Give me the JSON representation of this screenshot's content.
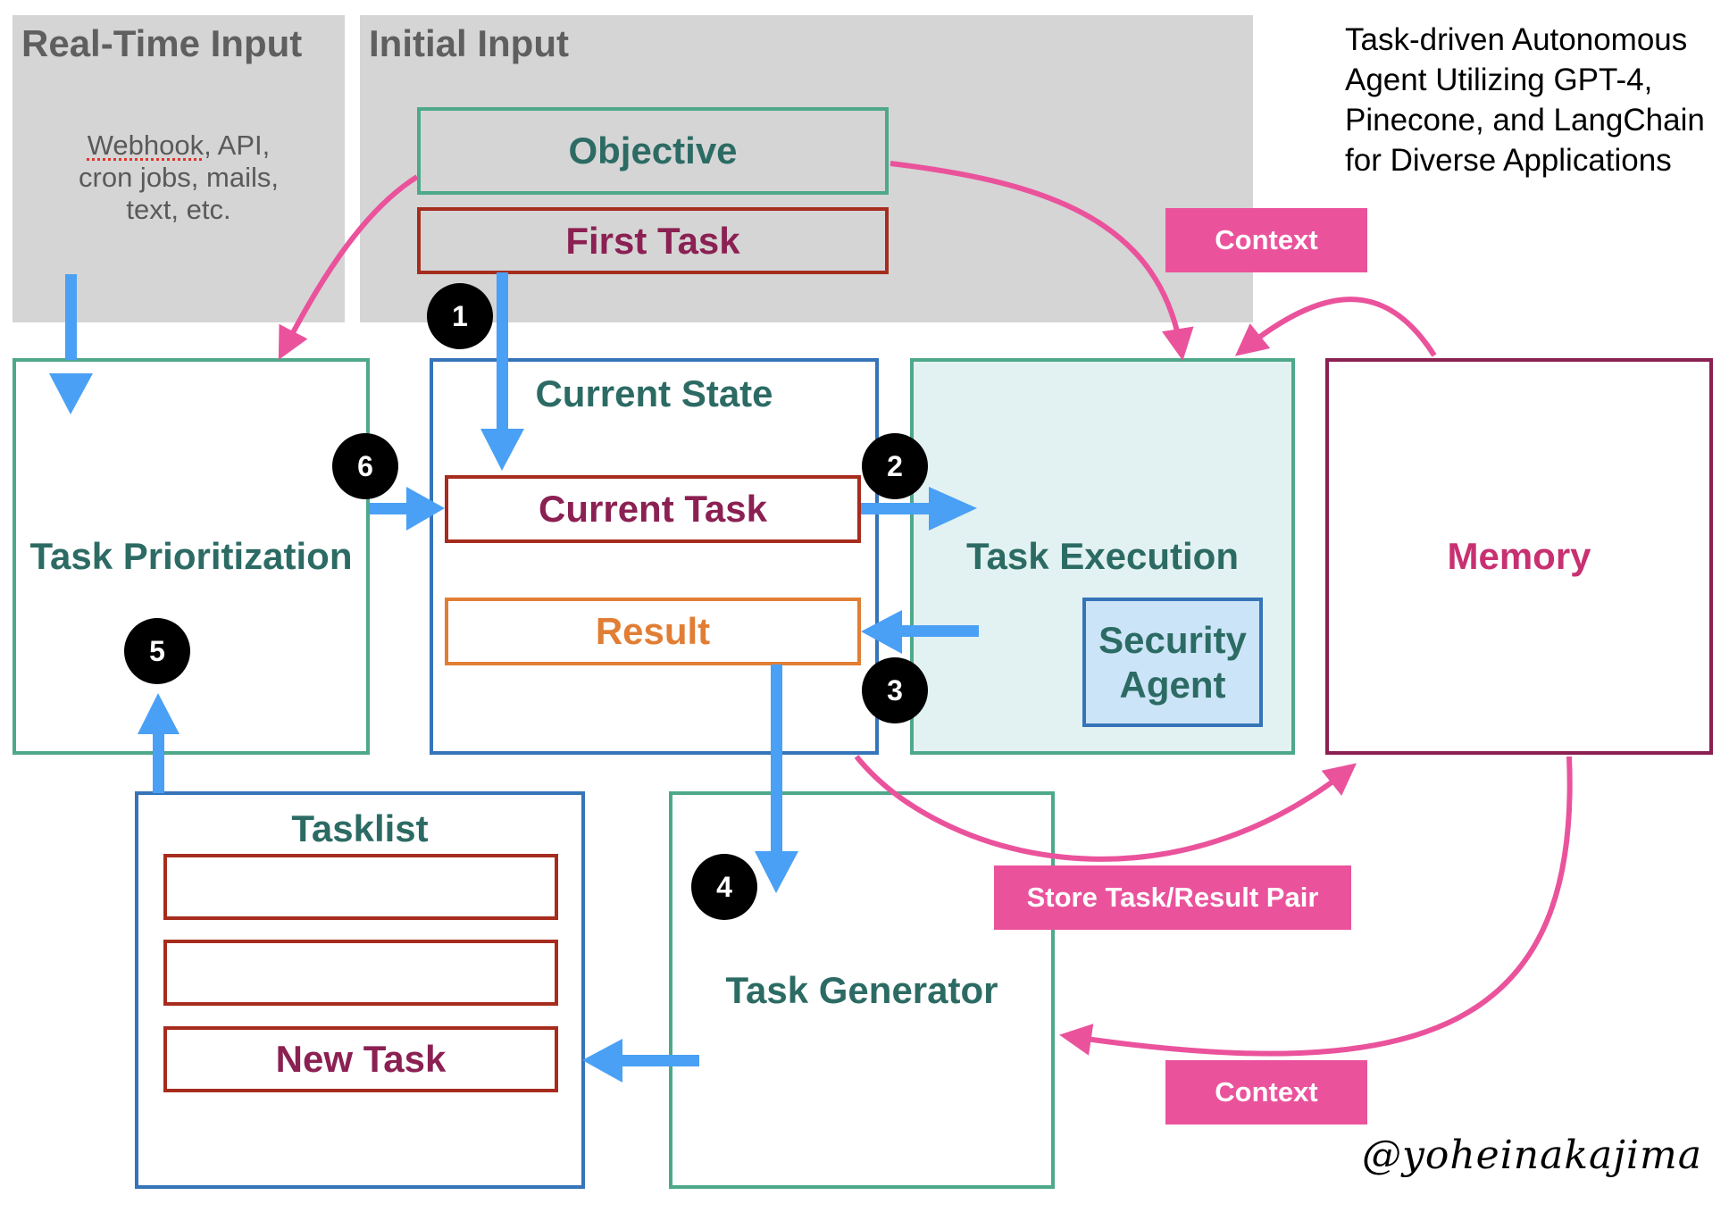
{
  "title": {
    "lines": [
      "Task-driven Autonomous",
      "Agent Utilizing GPT-4,",
      "Pinecone, and LangChain",
      "for Diverse Applications"
    ]
  },
  "realtime_input": {
    "title": "Real-Time Input",
    "sources_first": "Webhook",
    "sources_rest_line1": ", API,",
    "sources_line2": "cron jobs, mails,",
    "sources_line3": "text, etc."
  },
  "initial_input": {
    "title": "Initial Input",
    "objective": "Objective",
    "first_task": "First Task"
  },
  "task_prioritization": {
    "label": "Task Prioritization"
  },
  "current_state": {
    "title": "Current State",
    "current_task": "Current Task",
    "result": "Result"
  },
  "task_execution": {
    "label": "Task Execution",
    "security_agent_line1": "Security",
    "security_agent_line2": "Agent"
  },
  "memory": {
    "label": "Memory"
  },
  "tasklist": {
    "title": "Tasklist",
    "items": [
      "",
      "",
      "New Task"
    ]
  },
  "task_generator": {
    "label": "Task Generator"
  },
  "tags": {
    "context_top": "Context",
    "store_pair": "Store Task/Result Pair",
    "context_bottom": "Context"
  },
  "steps": [
    "1",
    "2",
    "3",
    "4",
    "5",
    "6"
  ],
  "signature": "@yoheinakajima",
  "colors": {
    "flow_arrow": "#4aa0f5",
    "context_arrow": "#ea539c",
    "teal_text": "#2c6b64",
    "plum": "#8b2052",
    "orange": "#e17e34",
    "gray_panel": "#d5d5d5"
  }
}
